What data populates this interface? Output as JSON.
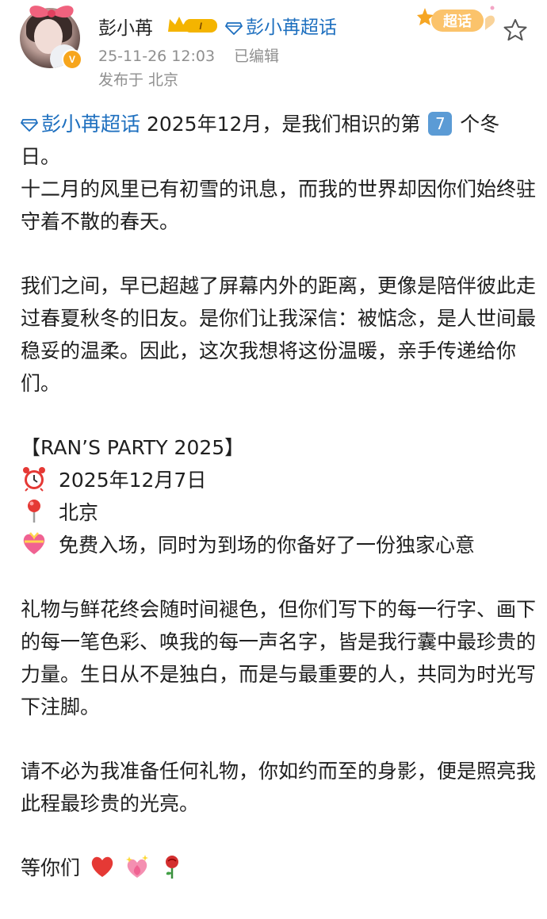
{
  "post": {
    "username": "彭小苒",
    "supertopic_link": "彭小苒超话",
    "timestamp": "25-11-26 12:03",
    "edited": "已编辑",
    "location": "发布于 北京",
    "supertopic_badge": "超话",
    "vip_level": "I",
    "verified_badge": "V"
  },
  "content": {
    "p1_link": "彭小苒超话",
    "p1_a": " 2025年12月，是我们相识的第 ",
    "p1_number": "7",
    "p1_b": " 个冬日。",
    "p1_c": "十二月的风里已有初雪的讯息，而我的世界却因你们始终驻守着不散的春天。",
    "p2": "我们之间，早已超越了屏幕内外的距离，更像是陪伴彼此走过春夏秋冬的旧友。是你们让我深信：被惦念，是人世间最稳妥的温柔。因此，这次我想将这份温暖，亲手传递给你们。",
    "event_title": "【RAN’S PARTY 2025】",
    "event_date": "2025年12月7日",
    "event_place": "北京",
    "event_note": "免费入场，同时为到场的你备好了一份独家心意",
    "p4": "礼物与鲜花终会随时间褪色，但你们写下的每一行字、画下的每一笔色彩、唤我的每一声名字，皆是我行囊中最珍贵的力量。生日从不是独白，而是与最重要的人，共同为时光写下注脚。",
    "p5": "请不必为我准备任何礼物，你如约而至的身影，便是照亮我此程最珍贵的光亮。",
    "closing": "等你们"
  },
  "icons": {
    "date": "alarm-clock-icon",
    "place": "pin-icon",
    "gift": "heart-gift-icon",
    "closing": [
      "red-heart-icon",
      "sparkling-heart-icon",
      "rose-icon"
    ]
  },
  "colors": {
    "link": "#1d6fbf",
    "meta": "#8f8f8f",
    "badge": "#f7a51c"
  }
}
